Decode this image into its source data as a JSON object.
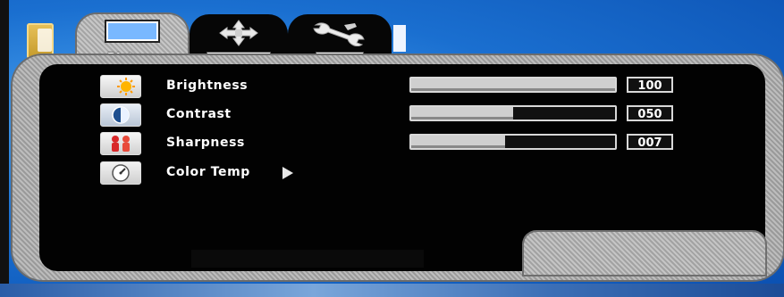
{
  "tabs": {
    "picture": {
      "label": "Picture",
      "icon": "monitor-icon"
    },
    "img_adj": {
      "label": "Img. Adj",
      "icon": "move-arrows-icon"
    },
    "setup": {
      "label": "Setup",
      "icon": "wrench-icon"
    }
  },
  "items": [
    {
      "label": "Brightness",
      "icon": "brightness-sun-icon",
      "value": "100",
      "level": 1.0
    },
    {
      "label": "Contrast",
      "icon": "contrast-icon",
      "value": "050",
      "level": 0.5
    },
    {
      "label": "Sharpness",
      "icon": "sharpness-people-icon",
      "value": "007",
      "level": 0.46
    },
    {
      "label": "Color Temp",
      "icon": "color-temp-dial-icon",
      "submenu_icon": "play-arrow-icon"
    }
  ],
  "colors": {
    "osd_background": "#020202",
    "frame": "#b0b0b0",
    "text": "#ffffff"
  }
}
